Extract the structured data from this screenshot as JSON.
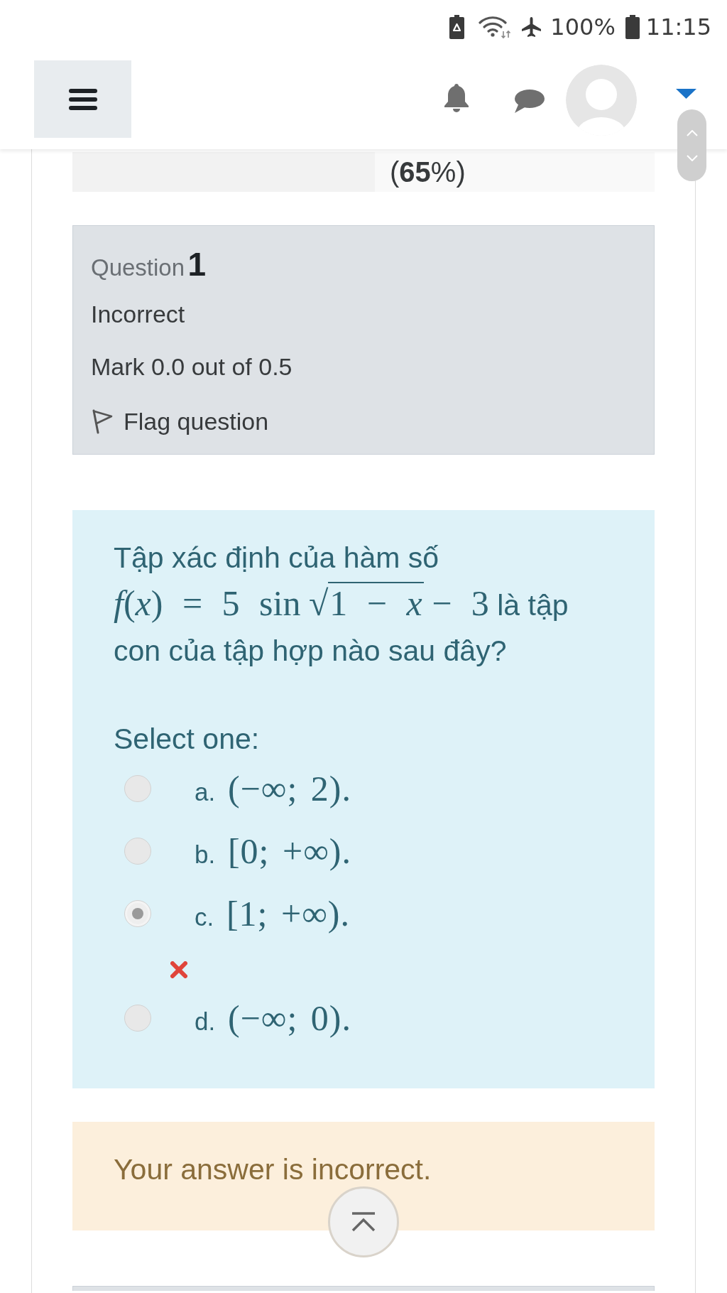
{
  "status_bar": {
    "battery_percent": "100%",
    "time": "11:15"
  },
  "grade_row": {
    "value": "(**65**%)"
  },
  "question_info": {
    "label": "Question",
    "number": "1",
    "status": "Incorrect",
    "mark": "Mark 0.0 out of 0.5",
    "flag": {
      "label": "Flag question",
      "flagged": false
    }
  },
  "question": {
    "text": [
      {
        "kind": "text",
        "text": "Tập xác định của hàm số"
      },
      {
        "kind": "math",
        "text": "*f*(*x*) = 5 sin"
      },
      {
        "kind": "sqrt",
        "sign": "√",
        "radicand": "1 − *x*"
      },
      {
        "kind": "math",
        "text": "− 3"
      },
      {
        "kind": "text",
        "text": "là tập con của tập hợp nào sau đây?"
      }
    ],
    "prompt": "Select one:",
    "options": [
      {
        "letter": "a.",
        "answer": "(−∞; 2).",
        "selected": false,
        "marked_incorrect": false
      },
      {
        "letter": "b.",
        "answer": "[0; +∞).",
        "selected": false,
        "marked_incorrect": false
      },
      {
        "letter": "c.",
        "answer": "[1; +∞).",
        "selected": true,
        "marked_incorrect": true
      },
      {
        "letter": "d.",
        "answer": "(−∞; 0).",
        "selected": false,
        "marked_incorrect": false
      }
    ]
  },
  "feedback": {
    "text": "Your answer is incorrect."
  }
}
